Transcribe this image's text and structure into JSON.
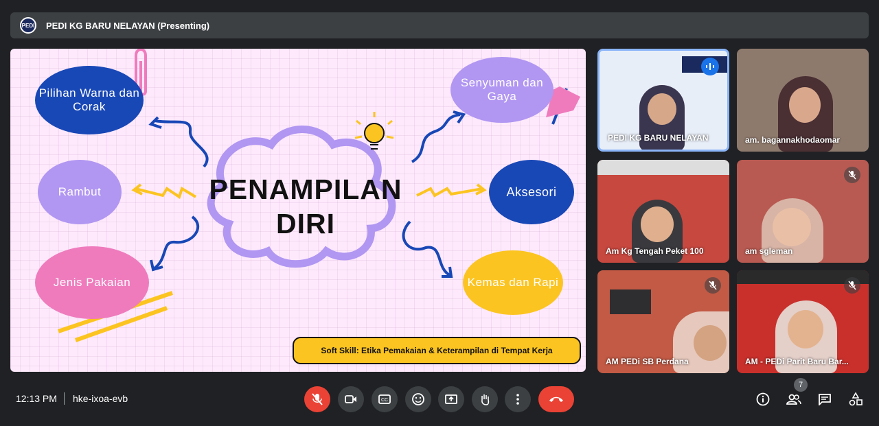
{
  "meeting": {
    "presenter_title": "PEDI KG BARU NELAYAN (Presenting)",
    "logo_text": "PEDI",
    "time": "12:13 PM",
    "code": "hke-ixoa-evb",
    "participant_count": "7"
  },
  "slide": {
    "title_line1": "PENAMPILAN",
    "title_line2": "DIRI",
    "bubbles": {
      "pilihan": "Pilihan Warna dan Corak",
      "rambut": "Rambut",
      "jenis": "Jenis Pakaian",
      "senyum": "Senyuman dan Gaya",
      "aksesori": "Aksesori",
      "kemas": "Kemas dan Rapi"
    },
    "footer": "Soft Skill: Etika Pemakaian & Keterampilan di Tempat Kerja"
  },
  "participants": [
    {
      "name": "PEDI KG BARU NELAYAN",
      "speaking": true
    },
    {
      "name": "am. bagannakhodaomar",
      "muted": false
    },
    {
      "name": "Am Kg Tengah Peket 100",
      "muted": false
    },
    {
      "name": "am sgleman",
      "muted": true
    },
    {
      "name": "AM PEDi SB Perdana",
      "muted": true
    },
    {
      "name": "AM - PEDi Parit Baru Bar...",
      "muted": true
    }
  ],
  "controls": [
    "mic-off",
    "camera",
    "captions",
    "emoji",
    "present",
    "raise-hand",
    "more",
    "leave-call"
  ],
  "right_controls": [
    "info",
    "people",
    "chat",
    "activities"
  ],
  "colors": {
    "accent_red": "#ea4335",
    "bar": "#3c4043",
    "bg": "#202124"
  }
}
